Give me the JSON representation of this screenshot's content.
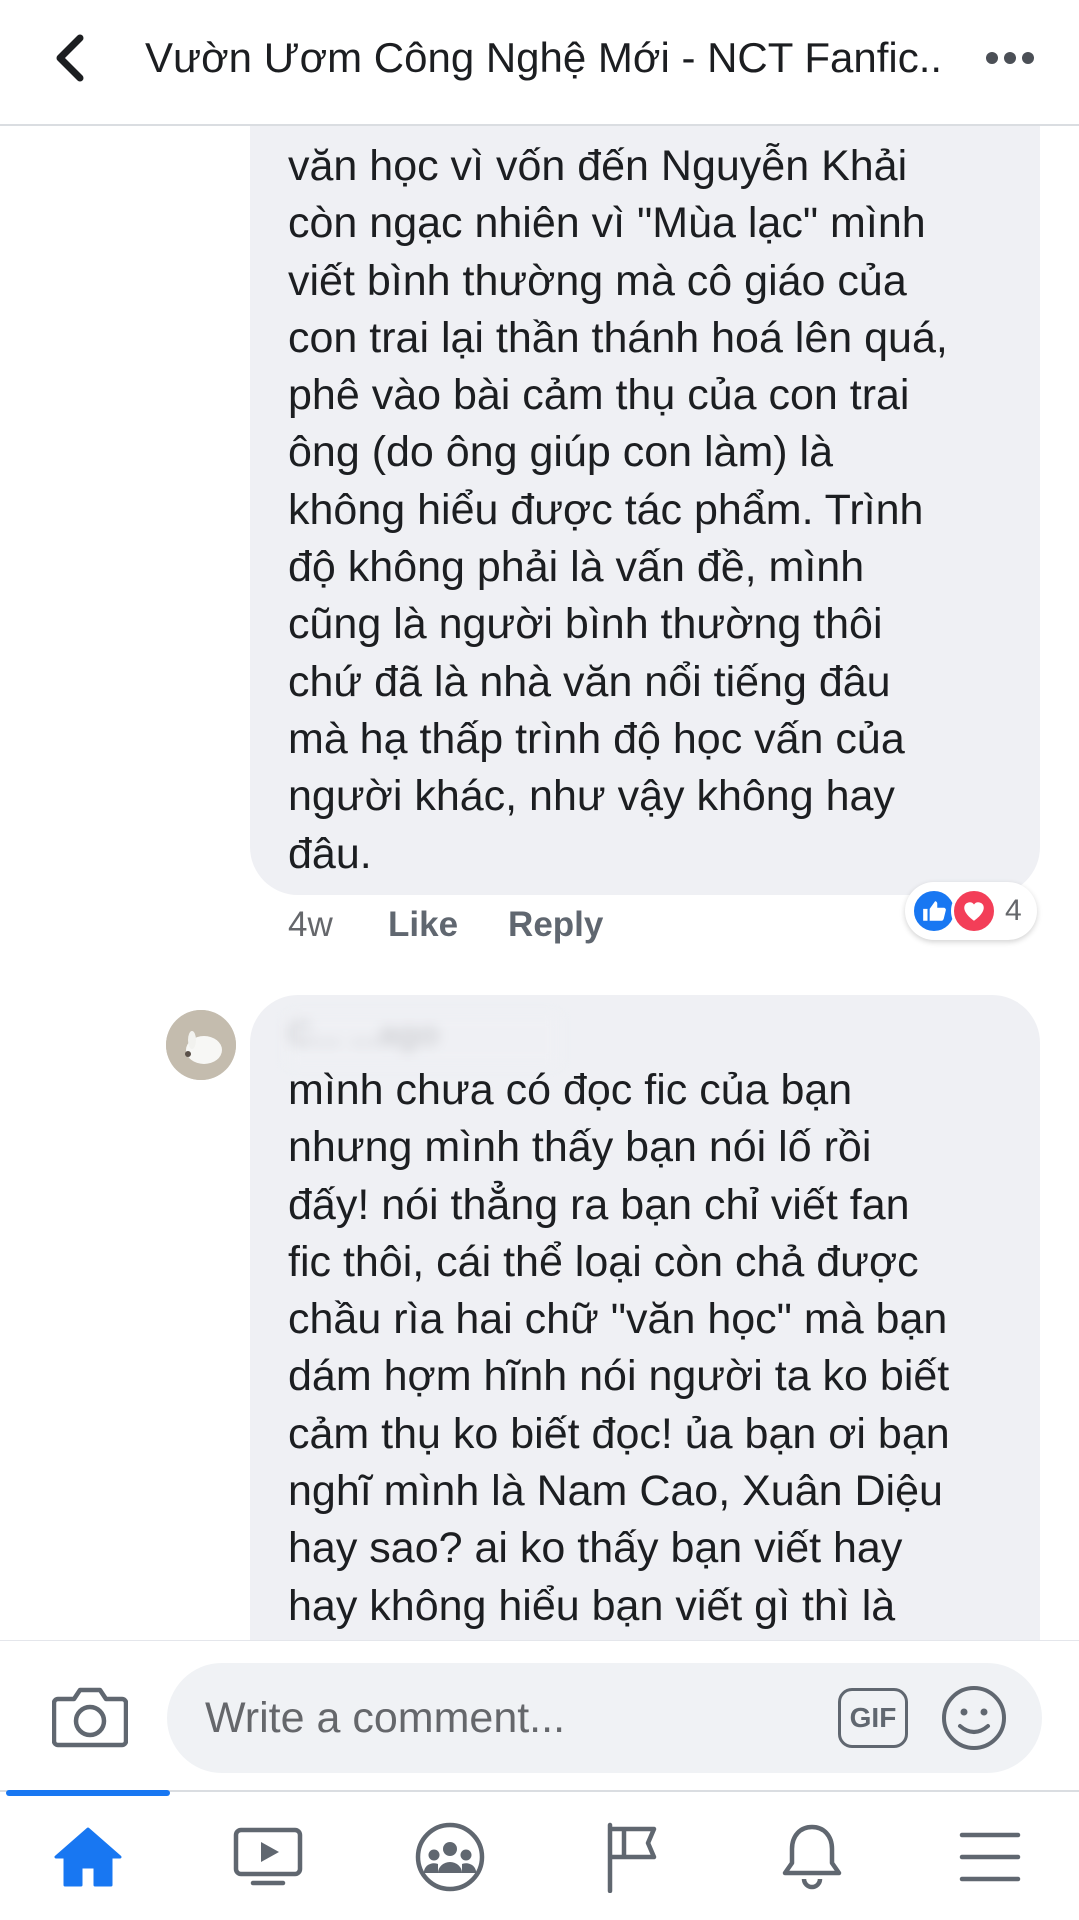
{
  "header": {
    "title": "Vườn Ươm Công Nghệ Mới - NCT Fanfic..."
  },
  "comments": [
    {
      "lines": [
        "văn học vì vốn đến Nguyễn Khải",
        "còn ngạc nhiên vì \"Mùa lạc\" mình",
        "viết bình thường mà cô giáo của",
        "con trai lại thần thánh hoá lên quá,",
        "phê vào bài cảm thụ của con trai",
        "ông (do ông giúp con làm) là",
        "không hiểu được tác phẩm. Trình",
        "độ không phải là vấn đề, mình",
        "cũng là người bình thường thôi",
        "chứ đã là nhà văn nổi tiếng đâu",
        "mà hạ thấp trình độ học vấn của",
        "người khác, như vậy không hay",
        "đâu."
      ],
      "time": "4w",
      "like_label": "Like",
      "reply_label": "Reply",
      "reactions": {
        "types": [
          "like",
          "love"
        ],
        "count": "4"
      }
    },
    {
      "author": "C... ...ago",
      "lines": [
        "mình chưa có đọc fic của bạn",
        "nhưng mình thấy bạn nói lố rồi",
        "đấy! nói thẳng ra bạn chỉ viết fan",
        "fic thôi, cái thể loại còn chả được",
        "chầu rìa hai chữ \"văn học\" mà bạn",
        "dám hợm hĩnh nói người ta ko biết",
        "cảm thụ ko biết đọc! ủa bạn ơi bạn",
        "nghĩ mình là Nam Cao, Xuân Diệu",
        "hay sao? ai ko thấy bạn viết hay",
        "hay không hiểu bạn viết gì thì là"
      ]
    }
  ],
  "composer": {
    "placeholder": "Write a comment...",
    "gif_label": "GIF"
  },
  "bottom_nav": {
    "items": [
      "home-icon",
      "watch-icon",
      "groups-icon",
      "pages-flag-icon",
      "notifications-bell-icon",
      "menu-icon"
    ],
    "active": "home-icon"
  },
  "colors": {
    "accent": "#1877f2",
    "bubble": "#eff0f4",
    "love": "#f33e58"
  }
}
